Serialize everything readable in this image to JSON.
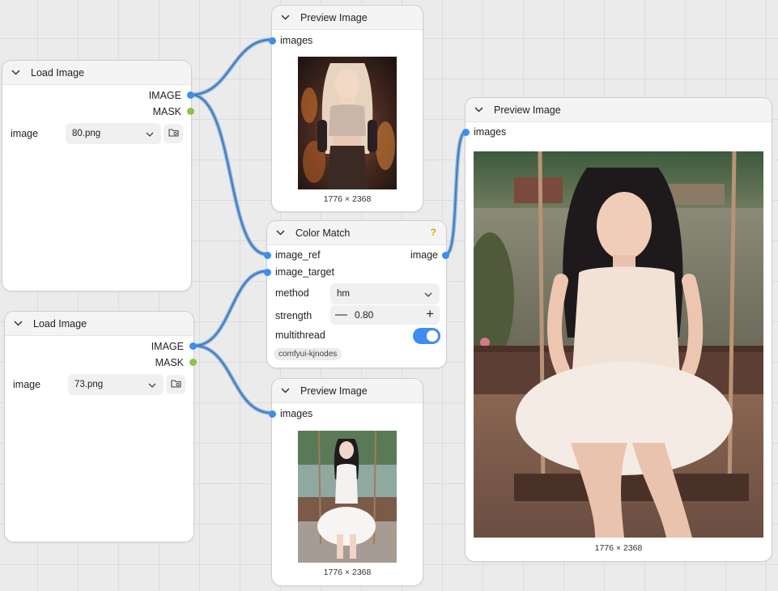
{
  "nodes": {
    "load_image_1": {
      "title": "Load Image",
      "outputs": [
        "IMAGE",
        "MASK"
      ],
      "widget_label": "image",
      "file_value": "80.png"
    },
    "load_image_2": {
      "title": "Load Image",
      "outputs": [
        "IMAGE",
        "MASK"
      ],
      "widget_label": "image",
      "file_value": "73.png"
    },
    "preview_top": {
      "title": "Preview Image",
      "input": "images",
      "image_size": "1776 × 2368"
    },
    "preview_bottom": {
      "title": "Preview Image",
      "input": "images",
      "image_size": "1776 × 2368"
    },
    "preview_right": {
      "title": "Preview Image",
      "input": "images",
      "image_size": "1776 × 2368"
    },
    "color_match": {
      "title": "Color Match",
      "help": "?",
      "inputs": [
        "image_ref",
        "image_target"
      ],
      "output": "image",
      "method_label": "method",
      "method_value": "hm",
      "strength_label": "strength",
      "strength_value": "0.80",
      "strength_minus": "—",
      "strength_plus": "+",
      "multithread_label": "multithread",
      "multithread_on": true,
      "source_badge": "comfyui-kjnodes"
    }
  },
  "colors": {
    "canvas": "#ebebeb",
    "link": "#4a87c9",
    "image_port": "#3d8ef0",
    "mask_port": "#8cc34a",
    "help": "#e4a800"
  },
  "icons": [
    "chevron-down-icon",
    "folder-icon",
    "help-icon"
  ]
}
